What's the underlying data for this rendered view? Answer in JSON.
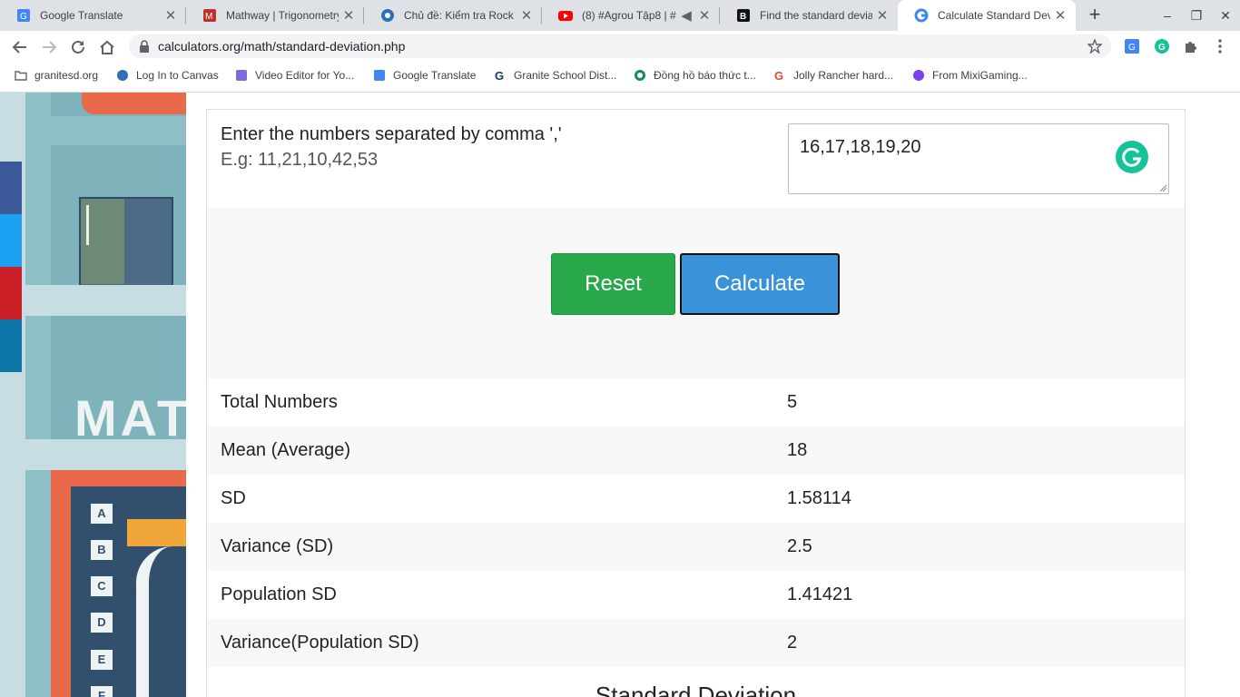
{
  "browser": {
    "tabs": [
      {
        "title": "Google Translate",
        "color": "#4285f4"
      },
      {
        "title": "Mathway | Trigonometry",
        "color": "#c0312b"
      },
      {
        "title": "Chủ đề: Kiểm tra Rock C",
        "color": "#2d6fb5"
      },
      {
        "title": "(8) #Agrou Tập8 | #",
        "color": "#ff0000"
      },
      {
        "title": "Find the standard deviat",
        "color": "#111111"
      },
      {
        "title": "Calculate Standard Devi",
        "color": "#4285f4"
      }
    ],
    "active_tab": 5,
    "url": "calculators.org/math/standard-deviation.php",
    "bookmarks": [
      {
        "label": "granitesd.org",
        "color": "#5f6368"
      },
      {
        "label": "Log In to Canvas",
        "color": "#2d6fb5"
      },
      {
        "label": "Video Editor for Yo...",
        "color": "#7b6cd9"
      },
      {
        "label": "Google Translate",
        "color": "#4285f4"
      },
      {
        "label": "Granite School Dist...",
        "color": "#0d3d6e"
      },
      {
        "label": "Đồng hồ báo thức t...",
        "color": "#1b8a5a"
      },
      {
        "label": "Jolly Rancher hard...",
        "color": "#ea4335"
      },
      {
        "label": "From MixiGaming...",
        "color": "#7e3ff2"
      }
    ]
  },
  "calculator": {
    "prompt": "Enter the numbers separated by comma ','",
    "example": "E.g: 11,21,10,42,53",
    "input_value": "16,17,18,19,20",
    "reset_label": "Reset",
    "calculate_label": "Calculate",
    "results": [
      {
        "label": "Total Numbers",
        "value": "5"
      },
      {
        "label": "Mean (Average)",
        "value": "18"
      },
      {
        "label": "SD",
        "value": "1.58114"
      },
      {
        "label": "Variance (SD)",
        "value": "2.5"
      },
      {
        "label": "Population SD",
        "value": "1.41421"
      },
      {
        "label": "Variance(Population SD)",
        "value": "2"
      }
    ],
    "next_heading": "Standard Deviation"
  },
  "art": {
    "side_text": "MAT",
    "letters": [
      "A",
      "B",
      "C",
      "D",
      "E",
      "F"
    ]
  }
}
